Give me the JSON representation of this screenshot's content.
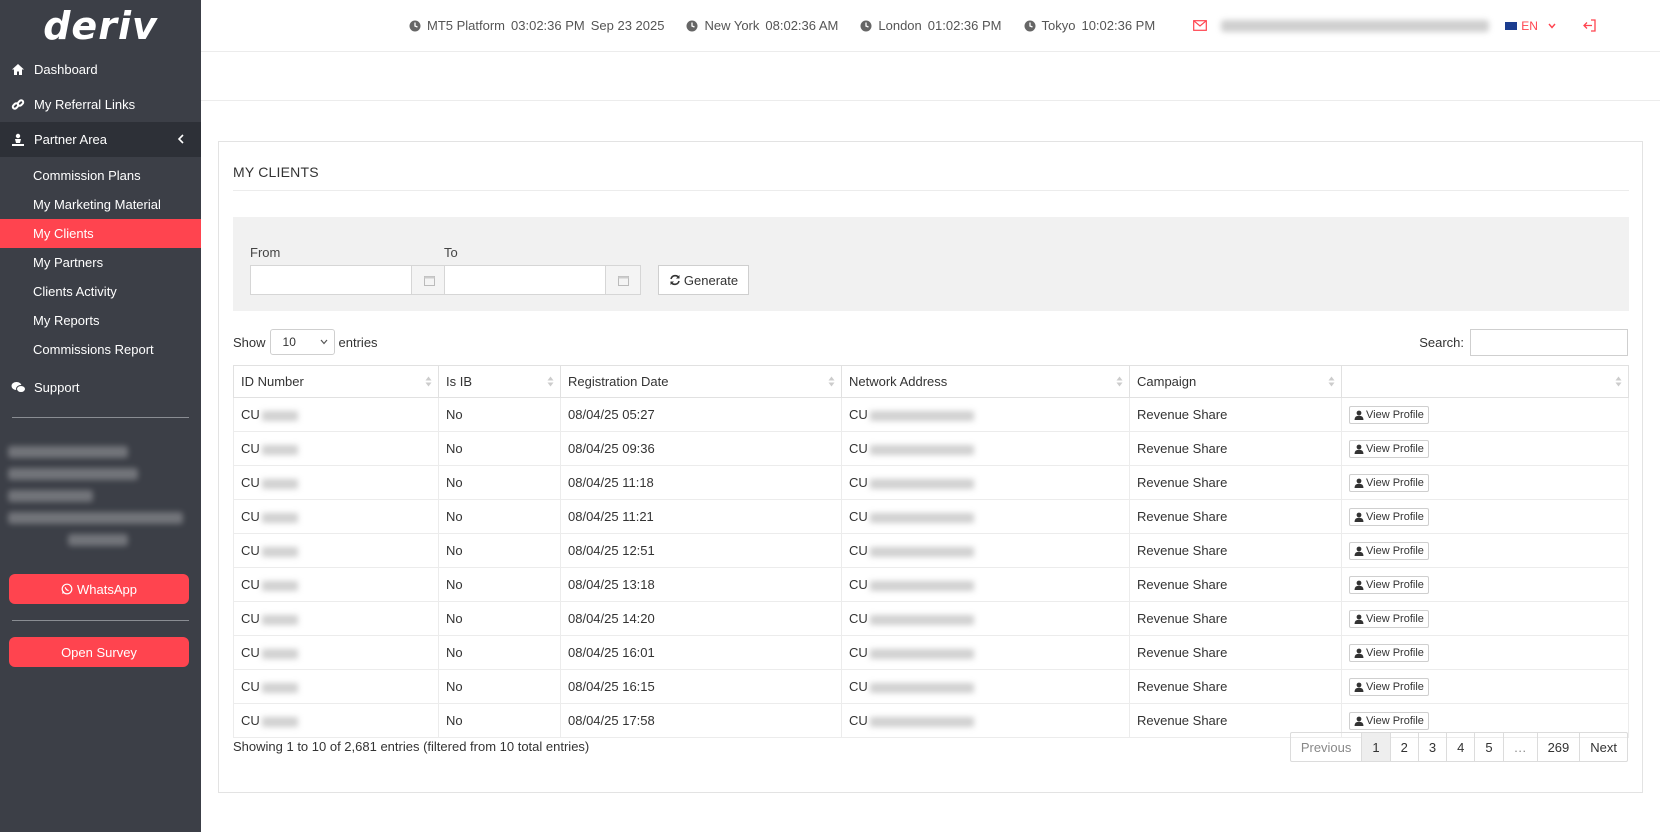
{
  "brand": {
    "logo": "deriv",
    "accent": "#ff444f",
    "sidebar_bg": "#3c3f47"
  },
  "sidebar": {
    "dashboard": "Dashboard",
    "referral": "My Referral Links",
    "partner_area": "Partner Area",
    "sub_items": [
      "Commission Plans",
      "My Marketing Material",
      "My Clients",
      "My Partners",
      "Clients Activity",
      "My Reports",
      "Commissions Report"
    ],
    "support": "Support",
    "whatsapp": "WhatsApp",
    "survey": "Open Survey"
  },
  "topbar": {
    "clocks": [
      {
        "city": "MT5 Platform",
        "time": "03:02:36 PM",
        "date": "Sep 23 2025"
      },
      {
        "city": "New York",
        "time": "08:02:36 AM",
        "date": ""
      },
      {
        "city": "London",
        "time": "01:02:36 PM",
        "date": ""
      },
      {
        "city": "Tokyo",
        "time": "10:02:36 PM",
        "date": ""
      }
    ],
    "lang": "EN"
  },
  "main": {
    "title": "MY CLIENTS",
    "from_label": "From",
    "to_label": "To",
    "generate": "Generate",
    "show_label": "Show",
    "entries_label": "entries",
    "page_size": "10",
    "search_label": "Search:",
    "columns": [
      "ID Number",
      "Is IB",
      "Registration Date",
      "Network Address",
      "Campaign",
      ""
    ],
    "rows": [
      {
        "id": "CU",
        "is_ib": "No",
        "date": "08/04/25 05:27",
        "net": "CU",
        "campaign": "Revenue Share",
        "action": "View Profile"
      },
      {
        "id": "CU",
        "is_ib": "No",
        "date": "08/04/25 09:36",
        "net": "CU",
        "campaign": "Revenue Share",
        "action": "View Profile"
      },
      {
        "id": "CU",
        "is_ib": "No",
        "date": "08/04/25 11:18",
        "net": "CU",
        "campaign": "Revenue Share",
        "action": "View Profile"
      },
      {
        "id": "CU",
        "is_ib": "No",
        "date": "08/04/25 11:21",
        "net": "CU",
        "campaign": "Revenue Share",
        "action": "View Profile"
      },
      {
        "id": "CU",
        "is_ib": "No",
        "date": "08/04/25 12:51",
        "net": "CU",
        "campaign": "Revenue Share",
        "action": "View Profile"
      },
      {
        "id": "CU",
        "is_ib": "No",
        "date": "08/04/25 13:18",
        "net": "CU",
        "campaign": "Revenue Share",
        "action": "View Profile"
      },
      {
        "id": "CU",
        "is_ib": "No",
        "date": "08/04/25 14:20",
        "net": "CU",
        "campaign": "Revenue Share",
        "action": "View Profile"
      },
      {
        "id": "CU",
        "is_ib": "No",
        "date": "08/04/25 16:01",
        "net": "CU",
        "campaign": "Revenue Share",
        "action": "View Profile"
      },
      {
        "id": "CU",
        "is_ib": "No",
        "date": "08/04/25 16:15",
        "net": "CU",
        "campaign": "Revenue Share",
        "action": "View Profile"
      },
      {
        "id": "CU",
        "is_ib": "No",
        "date": "08/04/25 17:58",
        "net": "CU",
        "campaign": "Revenue Share",
        "action": "View Profile"
      }
    ],
    "info": "Showing 1 to 10 of 2,681 entries (filtered from 10 total entries)",
    "pagination": [
      "Previous",
      "1",
      "2",
      "3",
      "4",
      "5",
      "…",
      "269",
      "Next"
    ]
  }
}
